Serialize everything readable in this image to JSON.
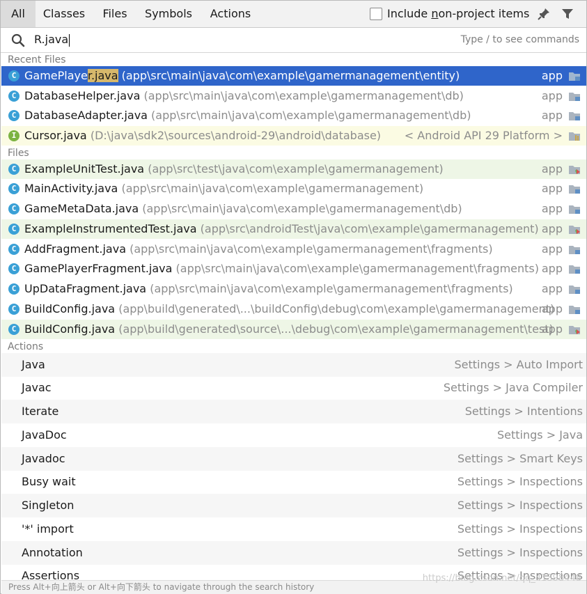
{
  "tabs": [
    {
      "label": "All",
      "active": true
    },
    {
      "label": "Classes"
    },
    {
      "label": "Files"
    },
    {
      "label": "Symbols"
    },
    {
      "label": "Actions"
    }
  ],
  "include_non_project": {
    "prefix": "Include ",
    "underlined": "n",
    "rest": "on-project items",
    "checked": false
  },
  "search": {
    "value": "R.java",
    "hint": "Type / to see commands"
  },
  "sections": {
    "recent": "Recent Files",
    "files": "Files",
    "actions": "Actions"
  },
  "recent_files": [
    {
      "name_pre": "GamePlaye",
      "name_hl": "r.java",
      "path": " (app\\src\\main\\java\\com\\example\\gamermanagement\\entity)",
      "module": "app",
      "icon": "C",
      "selected": true
    },
    {
      "name_pre": "DatabaseHelper.java",
      "name_hl": "",
      "path": " (app\\src\\main\\java\\com\\example\\gamermanagement\\db)",
      "module": "app",
      "icon": "C"
    },
    {
      "name_pre": "DatabaseAdapter.java",
      "name_hl": "",
      "path": " (app\\src\\main\\java\\com\\example\\gamermanagement\\db)",
      "module": "app",
      "icon": "C"
    },
    {
      "name_pre": "Cursor.java",
      "name_hl": "",
      "path": " (D:\\java\\sdk2\\sources\\android-29\\android\\database)",
      "module": "< Android API 29 Platform >",
      "icon": "I",
      "tint": "yellow"
    }
  ],
  "files": [
    {
      "name": "ExampleUnitTest.java",
      "path": " (app\\src\\test\\java\\com\\example\\gamermanagement)",
      "module": "app",
      "icon": "C",
      "tint": "green"
    },
    {
      "name": "MainActivity.java",
      "path": " (app\\src\\main\\java\\com\\example\\gamermanagement)",
      "module": "app",
      "icon": "C"
    },
    {
      "name": "GameMetaData.java",
      "path": " (app\\src\\main\\java\\com\\example\\gamermanagement\\db)",
      "module": "app",
      "icon": "C"
    },
    {
      "name": "ExampleInstrumentedTest.java",
      "path": " (app\\src\\androidTest\\java\\com\\example\\gamermanagement)",
      "module": "app",
      "icon": "C",
      "tint": "green"
    },
    {
      "name": "AddFragment.java",
      "path": " (app\\src\\main\\java\\com\\example\\gamermanagement\\fragments)",
      "module": "app",
      "icon": "C"
    },
    {
      "name": "GamePlayerFragment.java",
      "path": " (app\\src\\main\\java\\com\\example\\gamermanagement\\fragments)",
      "module": "app",
      "icon": "C"
    },
    {
      "name": "UpDataFragment.java",
      "path": " (app\\src\\main\\java\\com\\example\\gamermanagement\\fragments)",
      "module": "app",
      "icon": "C"
    },
    {
      "name": "BuildConfig.java",
      "path": " (app\\build\\generated\\...\\buildConfig\\debug\\com\\example\\gamermanagement)",
      "module": "app",
      "icon": "C"
    },
    {
      "name": "BuildConfig.java",
      "path": " (app\\build\\generated\\source\\...\\debug\\com\\example\\gamermanagement\\test)",
      "module": "app",
      "icon": "C",
      "tint": "green"
    }
  ],
  "actions": [
    {
      "label": "Java",
      "location": "Settings > Auto Import"
    },
    {
      "label": "Javac",
      "location": "Settings > Java Compiler"
    },
    {
      "label": "Iterate",
      "location": "Settings > Intentions"
    },
    {
      "label": "JavaDoc",
      "location": "Settings > Java"
    },
    {
      "label": "Javadoc",
      "location": "Settings > Smart Keys"
    },
    {
      "label": "Busy wait",
      "location": "Settings > Inspections"
    },
    {
      "label": "Singleton",
      "location": "Settings > Inspections"
    },
    {
      "label": "'*' import",
      "location": "Settings > Inspections"
    },
    {
      "label": "Annotation",
      "location": "Settings > Inspections"
    },
    {
      "label": "Assertions",
      "location": "Settings > Inspections"
    }
  ],
  "footer": "Press Alt+向上箭头 or Alt+向下箭头 to navigate through the search history",
  "watermark": "https://blog.csdn.net/qq_41398448",
  "colors": {
    "selection": "#2f65ca",
    "highlight": "#d7b86b",
    "class_icon": "#3aa0d6",
    "interface_icon": "#7cb342"
  }
}
